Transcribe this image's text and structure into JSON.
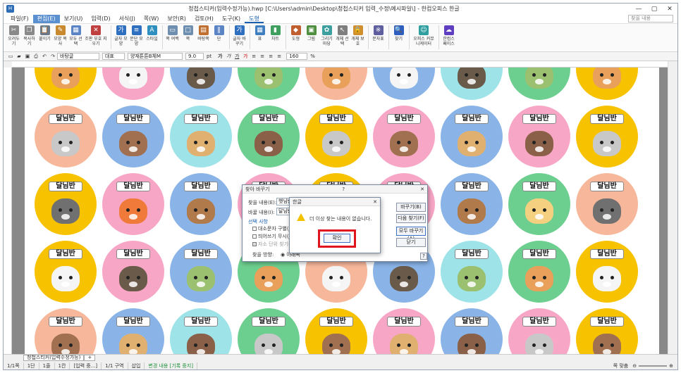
{
  "window": {
    "title": "청첩스티커(입력수정가능).hwp [C:\\Users\\admin\\Desktop\\청첩스티커 입력_수정\\예시파일\\] - 한컴오피스 한글"
  },
  "menu": {
    "items": [
      "파일(F)",
      "편집(E)",
      "보기(U)",
      "입력(D)",
      "서식(J)",
      "쪽(W)",
      "보안(R)",
      "검토(H)",
      "도구(K)",
      "도형"
    ],
    "active_index": 1,
    "tool_index": 9,
    "search_placeholder": "찾을 내용"
  },
  "ribbon": {
    "buttons": [
      {
        "label": "오려두기",
        "icon": "scissors-icon",
        "color": "#8a8a8a",
        "glyph": "✂"
      },
      {
        "label": "복사하기",
        "icon": "copy-icon",
        "color": "#8a8a8a",
        "glyph": "❐"
      },
      {
        "label": "붙이기",
        "icon": "paste-icon",
        "color": "#6a7a8a",
        "glyph": "📋"
      },
      {
        "label": "모양 복사",
        "icon": "format-painter-icon",
        "color": "#c9892e",
        "glyph": "✎"
      },
      {
        "label": "모두 선택",
        "icon": "select-all-icon",
        "color": "#5b84c4",
        "glyph": "▦"
      },
      {
        "label": "조판 부호 지우기",
        "icon": "erase-code-icon",
        "color": "#c04040",
        "glyph": "✕"
      },
      {
        "label": "글자 모양",
        "icon": "char-shape-icon",
        "color": "#2f6fbf",
        "glyph": "가"
      },
      {
        "label": "문단 모양",
        "icon": "para-shape-icon",
        "color": "#2f6fbf",
        "glyph": "≡"
      },
      {
        "label": "스타일",
        "icon": "style-icon",
        "color": "#2f8fbf",
        "glyph": "A"
      },
      {
        "label": "쪽 여백",
        "icon": "page-margin-icon",
        "color": "#6f8fb0",
        "glyph": "▭"
      },
      {
        "label": "쪽",
        "icon": "page-icon",
        "color": "#6f8fb0",
        "glyph": "□"
      },
      {
        "label": "바탕쪽",
        "icon": "master-page-icon",
        "color": "#c07030",
        "glyph": "▤"
      },
      {
        "label": "단",
        "icon": "columns-icon",
        "color": "#5b84c4",
        "glyph": "‖"
      },
      {
        "label": "글자 바꾸기",
        "icon": "replace-char-icon",
        "color": "#2f6fbf",
        "glyph": "가"
      },
      {
        "label": "표",
        "icon": "table-icon",
        "color": "#3f7fbf",
        "glyph": "▦"
      },
      {
        "label": "차트",
        "icon": "chart-icon",
        "color": "#3f9f5f",
        "glyph": "▮"
      },
      {
        "label": "도형",
        "icon": "shape-icon",
        "color": "#c06030",
        "glyph": "◆"
      },
      {
        "label": "그림",
        "icon": "picture-icon",
        "color": "#4f8f3f",
        "glyph": "▣"
      },
      {
        "label": "그리기마당",
        "icon": "clipart-icon",
        "color": "#3f9f9f",
        "glyph": "✿"
      },
      {
        "label": "개체 선택",
        "icon": "object-select-icon",
        "color": "#7f7f7f",
        "glyph": "↖"
      },
      {
        "label": "개체 보호",
        "icon": "object-lock-icon",
        "color": "#d0902f",
        "glyph": "🔒"
      },
      {
        "label": "문자표",
        "icon": "symbol-icon",
        "color": "#5f5f9f",
        "glyph": "※"
      },
      {
        "label": "찾기",
        "icon": "find-icon",
        "color": "#2f5fbf",
        "glyph": "🔍"
      },
      {
        "label": "오피스 커뮤니케이터",
        "icon": "communicator-icon",
        "color": "#2f9f9f",
        "glyph": "☺"
      },
      {
        "label": "한컴스페이스",
        "icon": "hancom-space-icon",
        "color": "#5f3fbf",
        "glyph": "☁"
      }
    ]
  },
  "format": {
    "style": "바탕글",
    "lang": "대표",
    "font": "양재튼튼B체M",
    "size": "9.0",
    "unit": "pt",
    "zoom": "160",
    "zoom_unit": "%"
  },
  "stickers": {
    "label": "달님반",
    "colors": [
      "#f7c200",
      "#f7a6c6",
      "#8ab4e8",
      "#6dcf8f",
      "#f7b79a",
      "#8ab4e8",
      "#9de3e8",
      "#6dcf8f",
      "#f7c200",
      "#f7a6c6",
      "#8ab4e8",
      "#f7a6c6"
    ]
  },
  "find_replace": {
    "title": "찾아 바꾸기",
    "find_label": "찾을 내용(E):",
    "find_value": "햇님반",
    "replace_label": "바꿀 내용(I):",
    "replace_value": "달님반",
    "options_label": "선택 사항",
    "opt1": "대소문자 구별(J)",
    "opt2": "띄어쓰기 무시(J)",
    "opt3": "자소 단위 찾기(I)",
    "direction_label": "찾을 방향:",
    "direction_value": "아래쪽",
    "btn_replace": "바꾸기(B)",
    "btn_find_next": "다음 찾기(F)",
    "btn_replace_all": "모두 바꾸기(A)",
    "btn_close": "닫기",
    "help": "?"
  },
  "alert": {
    "title": "한글",
    "message": "더 이상 찾는 내용이 없습니다.",
    "ok": "확인"
  },
  "status": {
    "sheet_tab": "청첩스티커(입력수정가능)",
    "add_tab": "+",
    "page": "1/1쪽",
    "column": "1단",
    "line": "1줄",
    "col": "1칸",
    "insert_info": "[입력 중...]",
    "section": "1/1 구역",
    "mode": "삽입",
    "track": "변경 내용 [기록 중지]",
    "zoom_mode": "쪽 맞춤"
  }
}
